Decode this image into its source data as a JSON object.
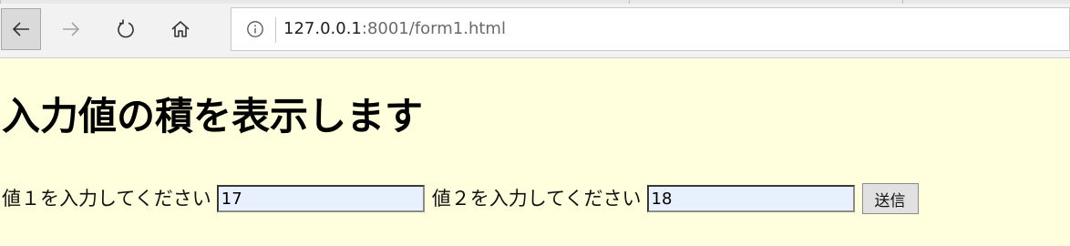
{
  "browser": {
    "url_host": "127.0.0.1",
    "url_rest": ":8001/form1.html"
  },
  "page": {
    "heading": "入力値の積を表示します",
    "form": {
      "label1": "値１を入力してください",
      "value1": "17",
      "label2": "値２を入力してください",
      "value2": "18",
      "submit_label": "送信"
    }
  },
  "colors": {
    "page_background": "#ffffdd",
    "input_background": "#e8f0fe",
    "toolbar_background": "#f2f2f2"
  },
  "icons": {
    "back": "back-arrow-icon",
    "forward": "forward-arrow-icon",
    "refresh": "refresh-icon",
    "home": "home-icon",
    "info": "info-icon"
  }
}
